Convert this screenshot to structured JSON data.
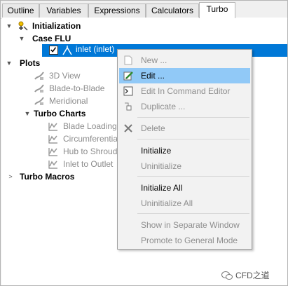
{
  "tabs": [
    {
      "label": "Outline"
    },
    {
      "label": "Variables"
    },
    {
      "label": "Expressions"
    },
    {
      "label": "Calculators"
    },
    {
      "label": "Turbo"
    }
  ],
  "active_tab": "Turbo",
  "tree": {
    "initialization": "Initialization",
    "case": "Case FLU",
    "inlet": "inlet (inlet)",
    "plots": "Plots",
    "plot_items": [
      "3D View",
      "Blade-to-Blade",
      "Meridional"
    ],
    "turbo_charts": "Turbo Charts",
    "chart_items": [
      "Blade Loading",
      "Circumferential",
      "Hub to Shroud",
      "Inlet to Outlet"
    ],
    "turbo_macros": "Turbo Macros"
  },
  "context_menu": {
    "new": "New ...",
    "edit": "Edit ...",
    "edit_command": "Edit In Command Editor",
    "duplicate": "Duplicate ...",
    "delete": "Delete",
    "initialize": "Initialize",
    "uninitialize": "Uninitialize",
    "initialize_all": "Initialize All",
    "uninitialize_all": "Uninitialize All",
    "show_separate": "Show in Separate Window",
    "promote": "Promote to General Mode"
  },
  "watermark": "CFD之道",
  "colors": {
    "selection": "#0078d7",
    "menu_highlight": "#91c9f7",
    "disabled_text": "#8e8e8e"
  }
}
